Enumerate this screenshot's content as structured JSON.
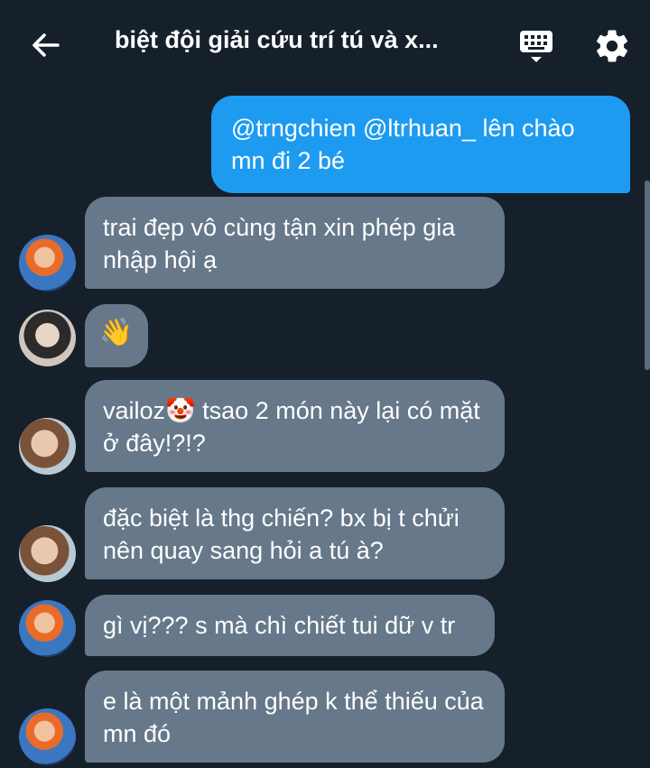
{
  "header": {
    "title": "biệt đội giải cứu trí tú và x..."
  },
  "messages": [
    {
      "text": "@trngchien @ltrhuan_ lên chào mn đi 2 bé"
    },
    {
      "text": "trai đẹp vô cùng tận xin phép gia nhập hội ạ"
    },
    {
      "text": "👋"
    },
    {
      "text_before": "vailoz",
      "emoji": "🤡",
      "text_after": " tsao 2 món này lại có mặt ở đây!?!?"
    },
    {
      "text": "đặc biệt là thg chiến? bx bị t chửi nên quay sang hỏi a tú à?"
    },
    {
      "text": "gì vị??? s mà chì chiết tui dữ v tr"
    },
    {
      "text": "e là một mảnh ghép k thể thiếu của mn đó"
    }
  ],
  "colors": {
    "background": "#15202b",
    "outgoing_bubble": "#1d9bf0",
    "incoming_bubble": "#66788a"
  },
  "icons": [
    "back-arrow-icon",
    "keyboard-icon",
    "gear-icon"
  ]
}
